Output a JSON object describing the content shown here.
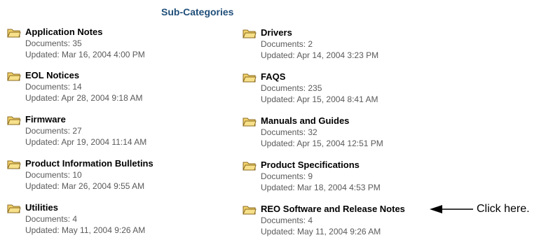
{
  "heading": "Sub-Categories",
  "colors": {
    "heading": "#1f4e79",
    "folder_fill": "#f3d36b",
    "folder_stroke": "#8a6a1f",
    "meta_text": "#5a5a5a"
  },
  "categories": [
    {
      "name": "Application Notes",
      "documents": "Documents: 35",
      "updated": "Updated: Mar 16, 2004 4:00 PM"
    },
    {
      "name": "Drivers",
      "documents": "Documents: 2",
      "updated": "Updated: Apr 14, 2004 3:23 PM"
    },
    {
      "name": "EOL Notices",
      "documents": "Documents: 14",
      "updated": "Updated: Apr 28, 2004 9:18 AM"
    },
    {
      "name": "FAQS",
      "documents": "Documents: 235",
      "updated": "Updated: Apr 15, 2004 8:41 AM"
    },
    {
      "name": "Firmware",
      "documents": "Documents: 27",
      "updated": "Updated: Apr 19, 2004 11:14 AM"
    },
    {
      "name": "Manuals and Guides",
      "documents": "Documents: 32",
      "updated": "Updated: Apr 15, 2004 12:51 PM"
    },
    {
      "name": "Product Information Bulletins",
      "documents": "Documents: 10",
      "updated": "Updated: Mar 26, 2004 9:55 AM"
    },
    {
      "name": "Product Specifications",
      "documents": "Documents: 9",
      "updated": "Updated: Mar 18, 2004 4:53 PM"
    },
    {
      "name": "Utilities",
      "documents": "Documents: 4",
      "updated": "Updated: May 11, 2004 9:26 AM"
    },
    {
      "name": "REO Software and Release Notes",
      "documents": "Documents: 4",
      "updated": "Updated: May 11, 2004 9:26 AM"
    }
  ],
  "callout": {
    "label": "Click here.",
    "icon": "left-arrow-icon"
  }
}
